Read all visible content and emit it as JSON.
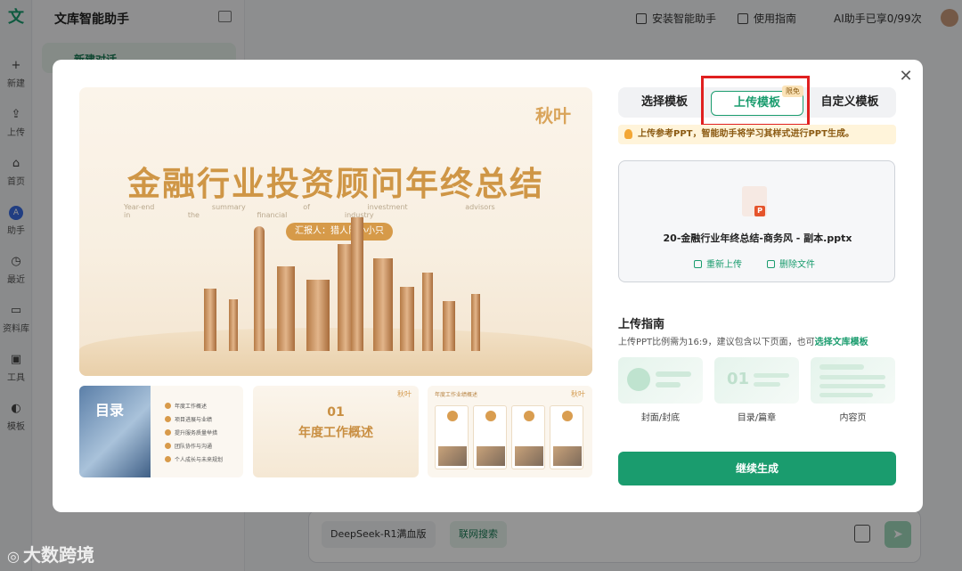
{
  "app": {
    "logo": "文",
    "title": "文库智能助手",
    "new_chat": "新建对话"
  },
  "rail": [
    {
      "label": "新建",
      "icon": "plus-icon"
    },
    {
      "label": "上传",
      "icon": "upload-icon"
    },
    {
      "label": "首页",
      "icon": "home-icon"
    },
    {
      "label": "助手",
      "icon": "assistant-icon"
    },
    {
      "label": "最近",
      "icon": "clock-icon"
    },
    {
      "label": "资料库",
      "icon": "folder-icon"
    },
    {
      "label": "工具",
      "icon": "toolbox-icon"
    },
    {
      "label": "模板",
      "icon": "palette-icon"
    }
  ],
  "topbar": {
    "install": "安装智能助手",
    "guide": "使用指南",
    "quota": "AI助手已享0/99次"
  },
  "input": {
    "model": "DeepSeek-R1满血版",
    "web_search": "联网搜索"
  },
  "watermark": "大数跨境",
  "modal": {
    "preview": {
      "brand": "秋叶",
      "title": "金融行业投资顾问年终总结",
      "subtitle_en": "Year-end summary of investment advisors in the financial industry",
      "reporter": "汇报人：猎人队小小只",
      "thumb1_heading": "目录",
      "thumb1_rows": [
        "年度工作概述",
        "项目进展与业绩",
        "提升服务质量举措",
        "团队协作与沟通",
        "个人成长与未来规划"
      ],
      "thumb2_number": "01",
      "thumb2_caption": "年度工作概述",
      "thumb2_brand": "秋叶",
      "thumb3_heading": "年度工作业绩概述",
      "thumb3_brand": "秋叶"
    },
    "tabs": {
      "select": "选择模板",
      "upload": "上传模板",
      "custom": "自定义模板",
      "free_badge": "限免"
    },
    "tip": "上传参考PPT，智能助手将学习其样式进行PPT生成。",
    "file": {
      "name": "20-金融行业年终总结-商务风 - 副本.pptx",
      "reupload": "重新上传",
      "delete": "删除文件",
      "type_badge": "P"
    },
    "guide": {
      "title": "上传指南",
      "desc": "上传PPT比例需为16:9，建议包含以下页面，也可",
      "link": "选择文库模板",
      "cards": [
        "封面/封底",
        "目录/篇章",
        "内容页"
      ],
      "card2_number": "01"
    },
    "continue": "继续生成"
  }
}
